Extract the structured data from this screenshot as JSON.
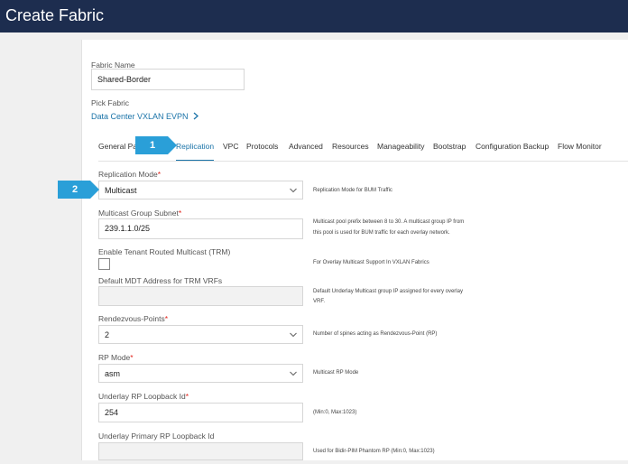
{
  "window": {
    "title": "Create Fabric"
  },
  "fabric_name": {
    "label": "Fabric Name",
    "value": "Shared-Border"
  },
  "pick_fabric": {
    "label": "Pick Fabric",
    "link": "Data Center VXLAN EVPN"
  },
  "tabs": [
    {
      "label": "General Pa"
    },
    {
      "label": "Replication"
    },
    {
      "label": "VPC"
    },
    {
      "label": "Protocols"
    },
    {
      "label": "Advanced"
    },
    {
      "label": "Resources"
    },
    {
      "label": "Manageability"
    },
    {
      "label": "Bootstrap"
    },
    {
      "label": "Configuration Backup"
    },
    {
      "label": "Flow Monitor"
    }
  ],
  "active_tab": "Replication",
  "callouts": {
    "one": "1",
    "two": "2"
  },
  "form": {
    "replication_mode": {
      "label": "Replication Mode",
      "req": "*",
      "value": "Multicast",
      "hint": "Replication Mode for BUM Traffic"
    },
    "multicast_group_subnet": {
      "label": "Multicast Group Subnet",
      "req": "*",
      "value": "239.1.1.0/25",
      "hint1": "Multicast pool prefix between 8 to 30. A multicast group IP from",
      "hint2": "this pool is used for BUM traffic for each overlay network."
    },
    "trm": {
      "label": "Enable Tenant Routed Multicast (TRM)",
      "checked": false,
      "hint": "For Overlay Multicast Support In VXLAN Fabrics"
    },
    "mdt": {
      "label": "Default MDT Address for TRM VRFs",
      "value": "",
      "hint1": "Default Underlay Multicast group IP assigned for every overlay",
      "hint2": "VRF."
    },
    "rendezvous_points": {
      "label": "Rendezvous-Points",
      "req": "*",
      "value": "2",
      "hint": "Number of spines acting as Rendezvous-Point (RP)"
    },
    "rp_mode": {
      "label": "RP Mode",
      "req": "*",
      "value": "asm",
      "hint": "Multicast RP Mode"
    },
    "underlay_rp_loopback": {
      "label": "Underlay RP Loopback Id",
      "req": "*",
      "value": "254",
      "hint": "(Min:0, Max:1023)"
    },
    "underlay_primary_rp_loopback": {
      "label": "Underlay Primary RP Loopback Id",
      "value": "",
      "hint": "Used for Bidir-PIM Phantom RP (Min:0, Max:1023)"
    }
  },
  "colors": {
    "titlebar": "#1d2d4f",
    "accent": "#1a73a8",
    "callout": "#2a9fd8",
    "required": "#e2231a"
  },
  "icons": {
    "chevron": "chevron-down-icon",
    "pick_arrow": "chevron-right-icon"
  }
}
